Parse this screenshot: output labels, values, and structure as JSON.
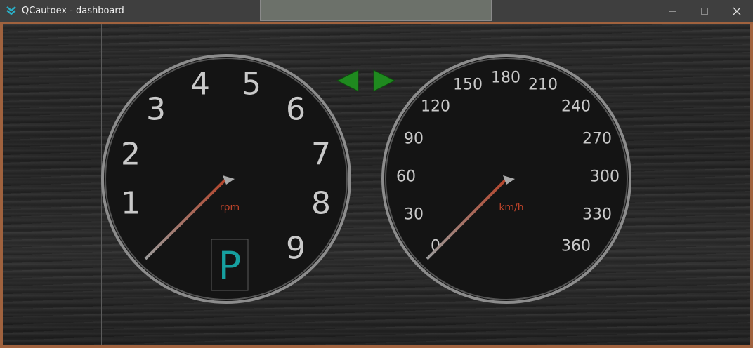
{
  "window": {
    "title": "QCautoex - dashboard",
    "controls": {
      "minimize": "minimize",
      "maximize": "maximize",
      "close": "close"
    }
  },
  "tachometer": {
    "unit": "rpm",
    "labels": [
      "1",
      "2",
      "3",
      "4",
      "5",
      "6",
      "7",
      "8",
      "9"
    ],
    "needle_value": 0
  },
  "speedometer": {
    "unit": "km/h",
    "labels": [
      "0",
      "30",
      "60",
      "90",
      "120",
      "150",
      "180",
      "210",
      "240",
      "270",
      "300",
      "330",
      "360"
    ],
    "needle_value": 0
  },
  "gear": {
    "value": "P"
  },
  "turn_signals": {
    "left": "left-arrow",
    "right": "right-arrow",
    "color": "#1f8a1f"
  },
  "colors": {
    "frame": "#a0623e",
    "needle": "#c0442a",
    "gear": "#16a0a0",
    "unit": "#c0442a"
  }
}
